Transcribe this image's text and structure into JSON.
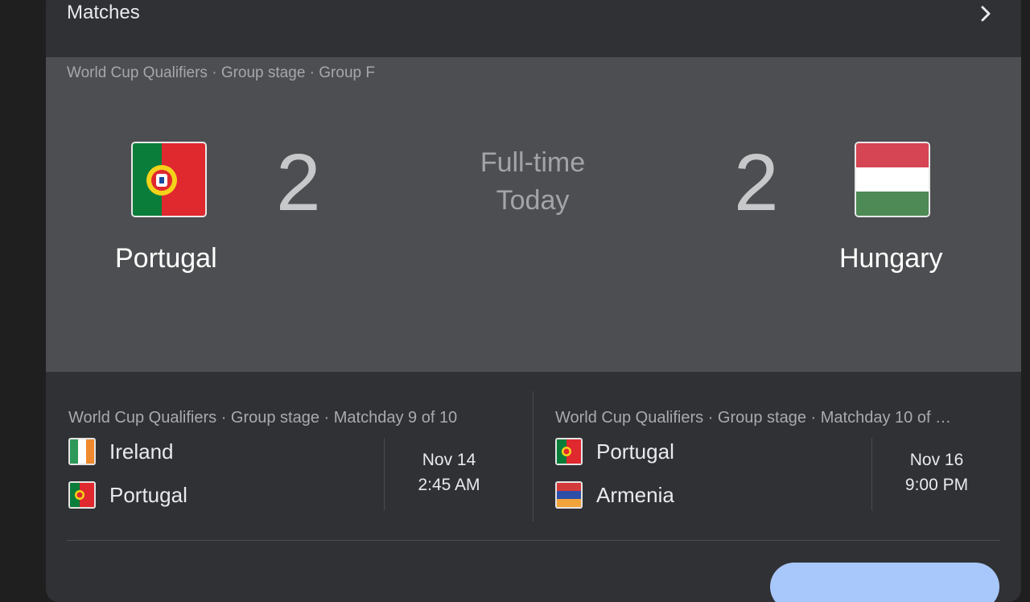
{
  "header": {
    "title": "Matches"
  },
  "main_match": {
    "competition": "World Cup Qualifiers · Group stage · Group F",
    "home": {
      "name": "Portugal",
      "score": "2",
      "flag": "portugal-flag"
    },
    "away": {
      "name": "Hungary",
      "score": "2",
      "flag": "hungary-flag"
    },
    "status": "Full-time",
    "date": "Today"
  },
  "upcoming": [
    {
      "competition": "World Cup Qualifiers · Group stage · Matchday 9 of 10",
      "team1": {
        "name": "Ireland",
        "flag": "ireland-flag"
      },
      "team2": {
        "name": "Portugal",
        "flag": "portugal-flag"
      },
      "date": "Nov 14",
      "time": "2:45 AM"
    },
    {
      "competition": "World Cup Qualifiers · Group stage · Matchday 10 of …",
      "team1": {
        "name": "Portugal",
        "flag": "portugal-flag"
      },
      "team2": {
        "name": "Armenia",
        "flag": "armenia-flag"
      },
      "date": "Nov 16",
      "time": "9:00 PM"
    }
  ],
  "colors": {
    "card_bg": "#303134",
    "main_match_bg": "#4d4e51",
    "accent_button": "#a8c7fa"
  }
}
